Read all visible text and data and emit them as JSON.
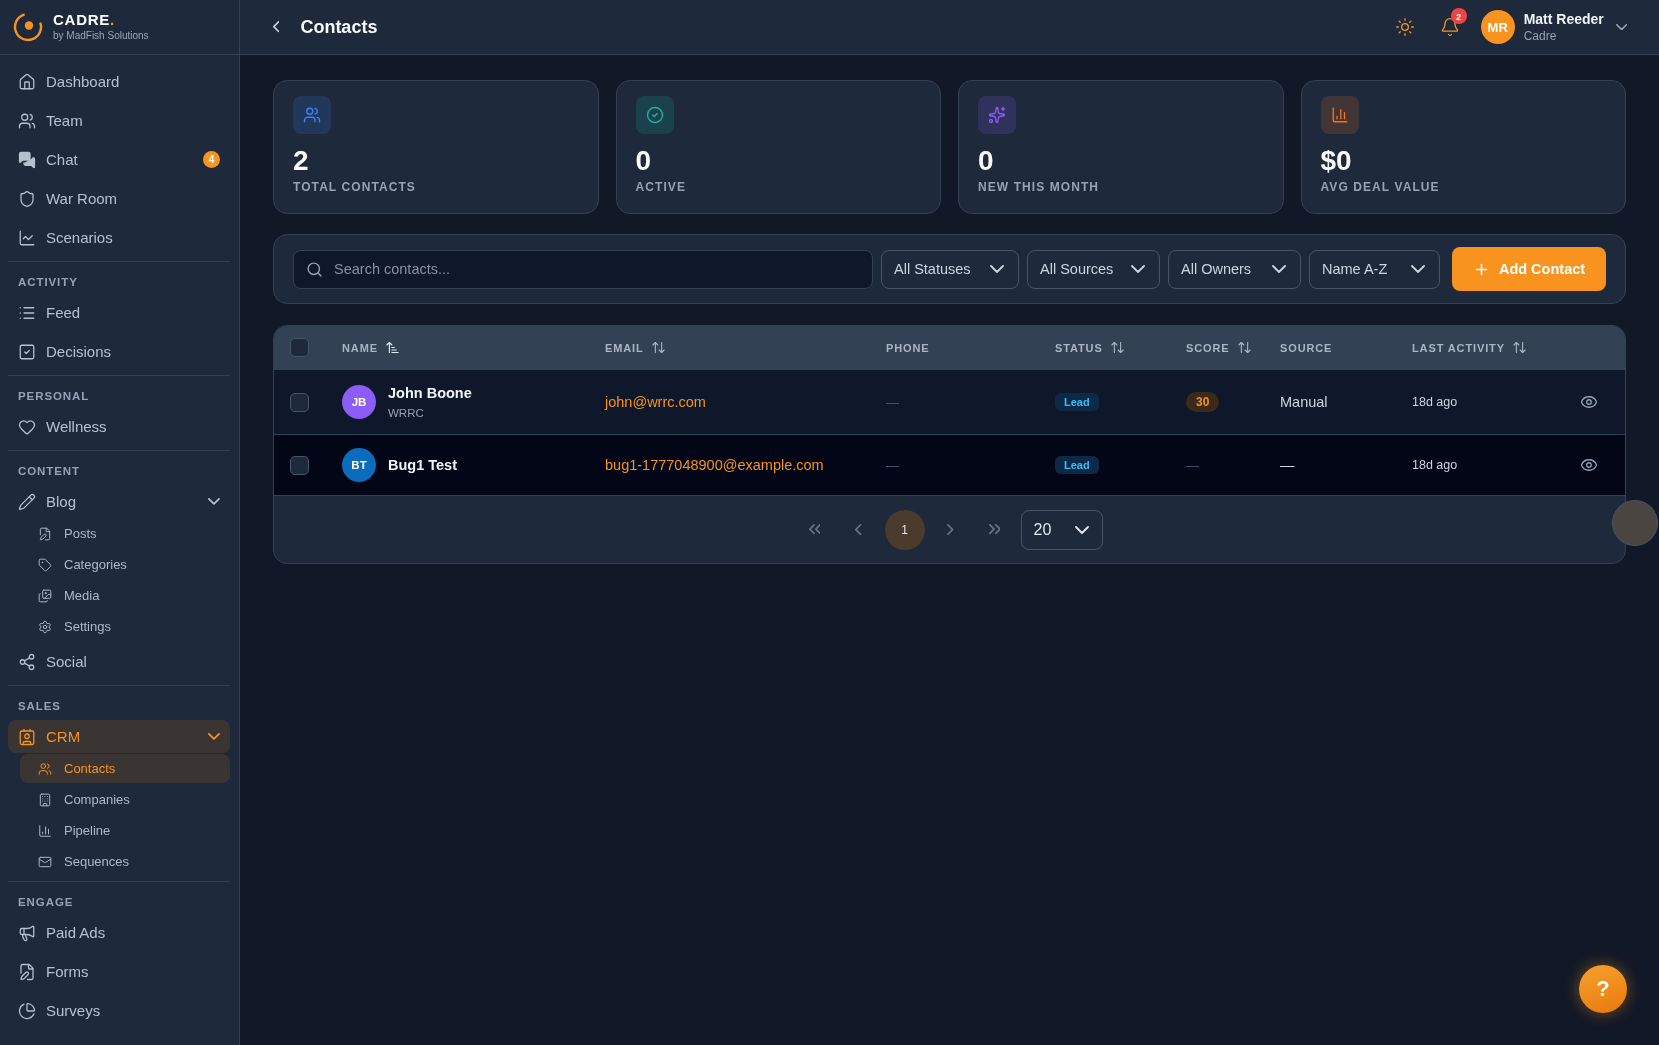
{
  "sidebar": {
    "logo": {
      "name": "CADRE",
      "mark": ".",
      "tagline": "by MadFish Solutions"
    },
    "sections": [
      {
        "items": [
          {
            "label": "Dashboard",
            "selected": false
          },
          {
            "label": "Team",
            "selected": false
          },
          {
            "label": "Chat",
            "selected": false,
            "badge": "4"
          },
          {
            "label": "War Room",
            "selected": false
          },
          {
            "label": "Scenarios",
            "selected": false
          }
        ]
      },
      {
        "label": "ACTIVITY",
        "items": [
          {
            "label": "Feed",
            "selected": false
          },
          {
            "label": "Decisions",
            "selected": false
          }
        ]
      },
      {
        "label": "PERSONAL",
        "items": [
          {
            "label": "Wellness",
            "selected": false
          }
        ]
      },
      {
        "label": "CONTENT",
        "items": [
          {
            "label": "Blog",
            "selected": false,
            "expanded": true,
            "children": [
              {
                "label": "Posts",
                "selected": false
              },
              {
                "label": "Categories",
                "selected": false
              },
              {
                "label": "Media",
                "selected": false
              },
              {
                "label": "Settings",
                "selected": false
              }
            ]
          },
          {
            "label": "Social",
            "selected": false
          }
        ]
      },
      {
        "label": "SALES",
        "items": [
          {
            "label": "CRM",
            "selected": true,
            "expanded": true,
            "children": [
              {
                "label": "Contacts",
                "selected": true
              },
              {
                "label": "Companies",
                "selected": false
              },
              {
                "label": "Pipeline",
                "selected": false
              },
              {
                "label": "Sequences",
                "selected": false
              }
            ]
          }
        ]
      },
      {
        "label": "ENGAGE",
        "items": [
          {
            "label": "Paid Ads",
            "selected": false
          },
          {
            "label": "Forms",
            "selected": false
          },
          {
            "label": "Surveys",
            "selected": false
          }
        ]
      }
    ]
  },
  "header": {
    "title": "Contacts",
    "notifications": "2",
    "user": {
      "initials": "MR",
      "name": "Matt Reeder",
      "org": "Cadre"
    }
  },
  "stats": [
    {
      "value": "2",
      "label": "TOTAL CONTACTS",
      "color": "#3b82f6"
    },
    {
      "value": "0",
      "label": "ACTIVE",
      "color": "#14b8a6"
    },
    {
      "value": "0",
      "label": "NEW THIS MONTH",
      "color": "#8b5cf6"
    },
    {
      "value": "$0",
      "label": "AVG DEAL VALUE",
      "color": "#f97316"
    }
  ],
  "filters": {
    "search": {
      "placeholder": "Search contacts..."
    },
    "selects": [
      "All Statuses",
      "All Sources",
      "All Owners",
      "Name A-Z"
    ],
    "add_button": "Add Contact"
  },
  "table": {
    "all_checked": false,
    "columns": [
      {
        "label": "NAME",
        "kind": "sortable",
        "sorted": true
      },
      {
        "label": "EMAIL",
        "kind": "sortable",
        "sorted": false
      },
      {
        "label": "PHONE",
        "kind": "plain"
      },
      {
        "label": "STATUS",
        "kind": "sortable",
        "sorted": false
      },
      {
        "label": "SCORE",
        "kind": "sortable",
        "sorted": false
      },
      {
        "label": "SOURCE",
        "kind": "plain"
      },
      {
        "label": "LAST ACTIVITY",
        "kind": "sortable",
        "sorted": false
      }
    ],
    "rows": [
      {
        "initials": "JB",
        "color": "#8b5cf6",
        "name": "John Boone",
        "company": "WRRC",
        "email": "john@wrrc.com",
        "phone": "—",
        "status": "Lead",
        "score": {
          "kind": "badge",
          "text": "30"
        },
        "source": "Manual",
        "last_activity": "18d ago",
        "checked": false,
        "highlighted": false
      },
      {
        "initials": "BT",
        "color": "#0b6cbd",
        "name": "Bug1 Test",
        "email": "bug1-1777048900@example.com",
        "phone": "—",
        "status": "Lead",
        "score": {
          "kind": "empty",
          "text": "—"
        },
        "source": "—",
        "last_activity": "18d ago",
        "checked": false,
        "highlighted": true
      }
    ]
  },
  "pagination": {
    "pages": [
      {
        "label": "1",
        "selected": true
      }
    ],
    "page_size": "20"
  },
  "help": {
    "label": "?"
  }
}
